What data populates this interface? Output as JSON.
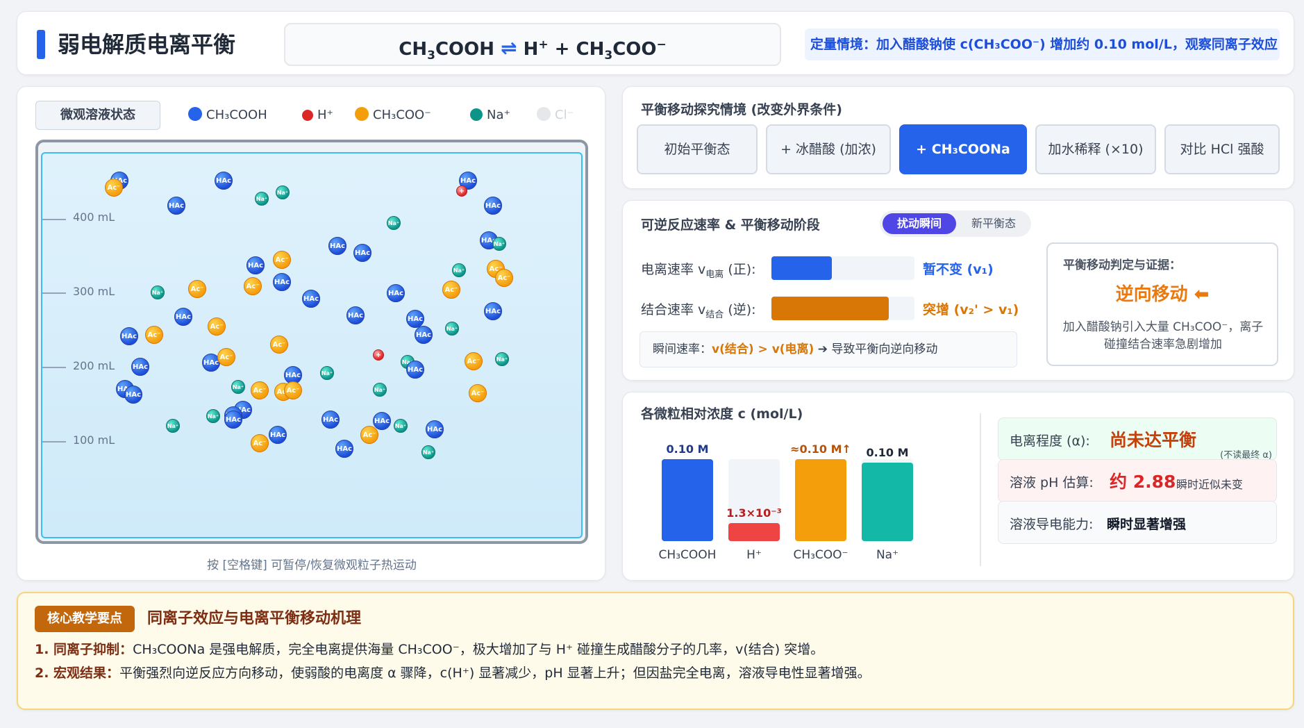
{
  "header": {
    "title": "弱电解质电离平衡",
    "equation": {
      "reactant": "CH",
      "reactant_sub": "3",
      "reactant_tail": "COOH",
      "arrow": "⇌",
      "product1": "H",
      "product1_sup": "+",
      "plus": "+",
      "product2": "CH",
      "product2_sub": "3",
      "product2_tail": "COO",
      "product2_sup": "−"
    },
    "scenario": "定量情境：加入醋酸钠使 c(CH₃COO⁻) 增加约 0.10 mol/L，观察同离子效应"
  },
  "beaker": {
    "state_label": "微观溶液状态",
    "legend": [
      {
        "label": "CH₃COOH",
        "color": "#2563eb"
      },
      {
        "label": "H⁺",
        "color": "#dc2626"
      },
      {
        "label": "CH₃COO⁻",
        "color": "#f59e0b"
      },
      {
        "label": "Na⁺",
        "color": "#0d9488"
      },
      {
        "label": "Cl⁻",
        "color": "#d1d5db"
      }
    ],
    "ticks": [
      "400 mL",
      "300 mL",
      "200 mL",
      "100 mL"
    ],
    "particle_labels": {
      "hac": "HAc",
      "ac": "Ac⁻",
      "na": "Na⁺",
      "h": "+"
    },
    "hint": "按 [空格键] 可暂停/恢复微观粒子热运动"
  },
  "controls": {
    "heading": "平衡移动探究情境 (改变外界条件)",
    "buttons": [
      "初始平衡态",
      "+ 冰醋酸 (加浓)",
      "+ CH₃COONa",
      "加水稀释 (×10)",
      "对比 HCl 强酸"
    ],
    "active_index": 2
  },
  "rates": {
    "heading": "可逆反应速率 & 平衡移动阶段",
    "toggle": [
      "扰动瞬间",
      "新平衡态"
    ],
    "forward": {
      "label": "电离速率 v",
      "sub": "电离",
      "dir": " (正):",
      "level": 0.42,
      "note": "暂不变 (v₁)",
      "color": "#2563eb"
    },
    "reverse": {
      "label": "结合速率 v",
      "sub": "结合",
      "dir": " (逆):",
      "level": 0.82,
      "note": "突增 (v₂' > v₁)",
      "color": "#d97706"
    },
    "instant": {
      "prefix": "瞬间速率：",
      "compare": "v(结合) > v(电离)",
      "suffix": " ➔ 导致平衡向逆向移动"
    },
    "judgement": {
      "title": "平衡移动判定与证据：",
      "result": "逆向移动 ⬅",
      "desc": "加入醋酸钠引入大量 CH₃COO⁻，离子碰撞结合速率急剧增加"
    }
  },
  "concentration": {
    "heading": "各微粒相对浓度 c (mol/L)",
    "bars": [
      {
        "name": "CH₃COOH",
        "value_label": "0.10 M",
        "level": 1.0,
        "color": "#2563eb",
        "label_color": "#1e3a8a"
      },
      {
        "name": "H⁺",
        "value_label": "1.3×10⁻³",
        "level": 0.22,
        "color": "#ef4444",
        "label_color": "#b91c1c"
      },
      {
        "name": "CH₃COO⁻",
        "value_label": "≈0.10 M↑",
        "level": 1.0,
        "color": "#f59e0b",
        "label_color": "#b45309"
      },
      {
        "name": "Na⁺",
        "value_label": "0.10 M",
        "level": 0.96,
        "color": "#14b8a6",
        "label_color": "#1f2937"
      }
    ],
    "stats": [
      {
        "label": "电离程度 (α):",
        "value": "尚未达平衡",
        "note": "(不读最终 α)",
        "value_color": "#c2410c",
        "bg": "#ecfdf3"
      },
      {
        "label": "溶液 pH 估算:",
        "value": "约 2.88",
        "note": "瞬时近似未变",
        "value_color": "#dc2626",
        "bg": "#fef2f2"
      },
      {
        "label": "溶液导电能力:",
        "value": "瞬时显著增强",
        "note": "",
        "value_color": "#111827",
        "bg": "#f8fafc"
      }
    ]
  },
  "notes": {
    "tag": "核心教学要点",
    "heading": "同离子效应与电离平衡移动机理",
    "lines": [
      {
        "label": "1. 同离子抑制：",
        "text": "CH₃COONa 是强电解质，完全电离提供海量 CH₃COO⁻，极大增加了与 H⁺ 碰撞生成醋酸分子的几率，v(结合) 突增。"
      },
      {
        "label": "2. 宏观结果：",
        "text": "平衡强烈向逆反应方向移动，使弱酸的电离度 α 骤降，c(H⁺) 显著减少，pH 显著上升；但因盐完全电离，溶液导电性显著增强。"
      }
    ]
  }
}
